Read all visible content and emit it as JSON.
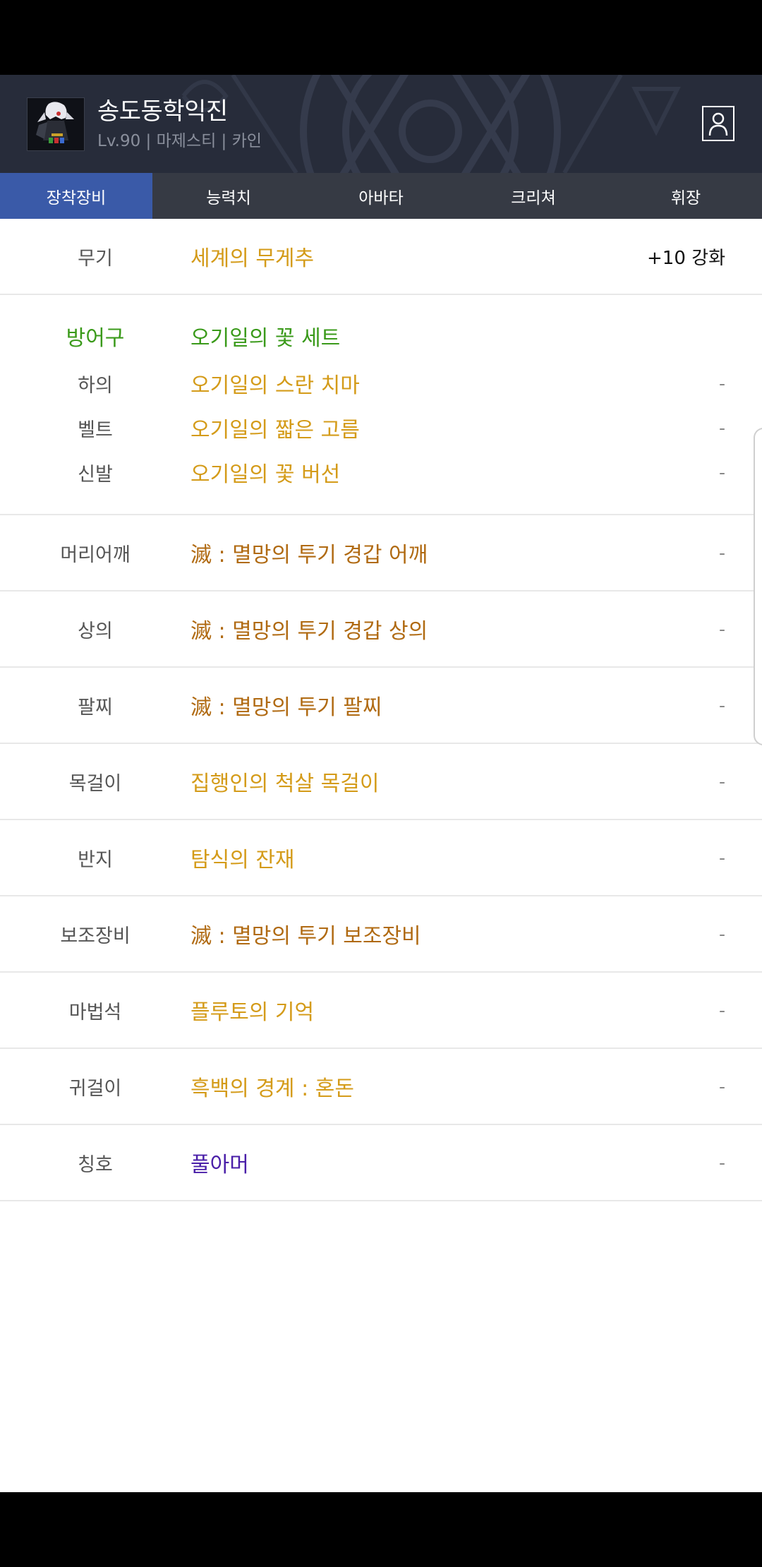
{
  "header": {
    "character_name": "송도동학익진",
    "subtitle": "Lv.90 | 마제스티 | 카인"
  },
  "tabs": [
    {
      "label": "장착장비",
      "active": true
    },
    {
      "label": "능력치",
      "active": false
    },
    {
      "label": "아바타",
      "active": false
    },
    {
      "label": "크리쳐",
      "active": false
    },
    {
      "label": "휘장",
      "active": false
    }
  ],
  "weapon": {
    "slot": "무기",
    "item": "세계의 무게추",
    "value": "+10 강화"
  },
  "armor_set": {
    "slot": "방어구",
    "set_name": "오기일의 꽃 세트",
    "items": [
      {
        "slot": "하의",
        "item": "오기일의 스란 치마",
        "value": "-"
      },
      {
        "slot": "벨트",
        "item": "오기일의 짧은 고름",
        "value": "-"
      },
      {
        "slot": "신발",
        "item": "오기일의 꽃 버선",
        "value": "-"
      }
    ]
  },
  "equipment": [
    {
      "slot": "머리어깨",
      "item": "滅 : 멸망의 투기 경갑 어깨",
      "value": "-",
      "rarity": "epic"
    },
    {
      "slot": "상의",
      "item": "滅 : 멸망의 투기 경갑 상의",
      "value": "-",
      "rarity": "epic"
    },
    {
      "slot": "팔찌",
      "item": "滅 : 멸망의 투기 팔찌",
      "value": "-",
      "rarity": "epic"
    },
    {
      "slot": "목걸이",
      "item": "집행인의 척살 목걸이",
      "value": "-",
      "rarity": "unique"
    },
    {
      "slot": "반지",
      "item": "탐식의 잔재",
      "value": "-",
      "rarity": "unique"
    },
    {
      "slot": "보조장비",
      "item": "滅 : 멸망의 투기 보조장비",
      "value": "-",
      "rarity": "epic"
    },
    {
      "slot": "마법석",
      "item": "플루토의 기억",
      "value": "-",
      "rarity": "unique"
    },
    {
      "slot": "귀걸이",
      "item": "흑백의 경계 : 혼돈",
      "value": "-",
      "rarity": "unique"
    },
    {
      "slot": "칭호",
      "item": "풀아머",
      "value": "-",
      "rarity": "title"
    }
  ],
  "colors": {
    "unique": "#d49b19",
    "epic": "#b06a12",
    "set": "#3a9a1a",
    "title": "#4a1fa8",
    "active_tab": "#3a5aa8"
  },
  "icons": {
    "profile": "profile-icon",
    "avatar": "character-avatar"
  }
}
